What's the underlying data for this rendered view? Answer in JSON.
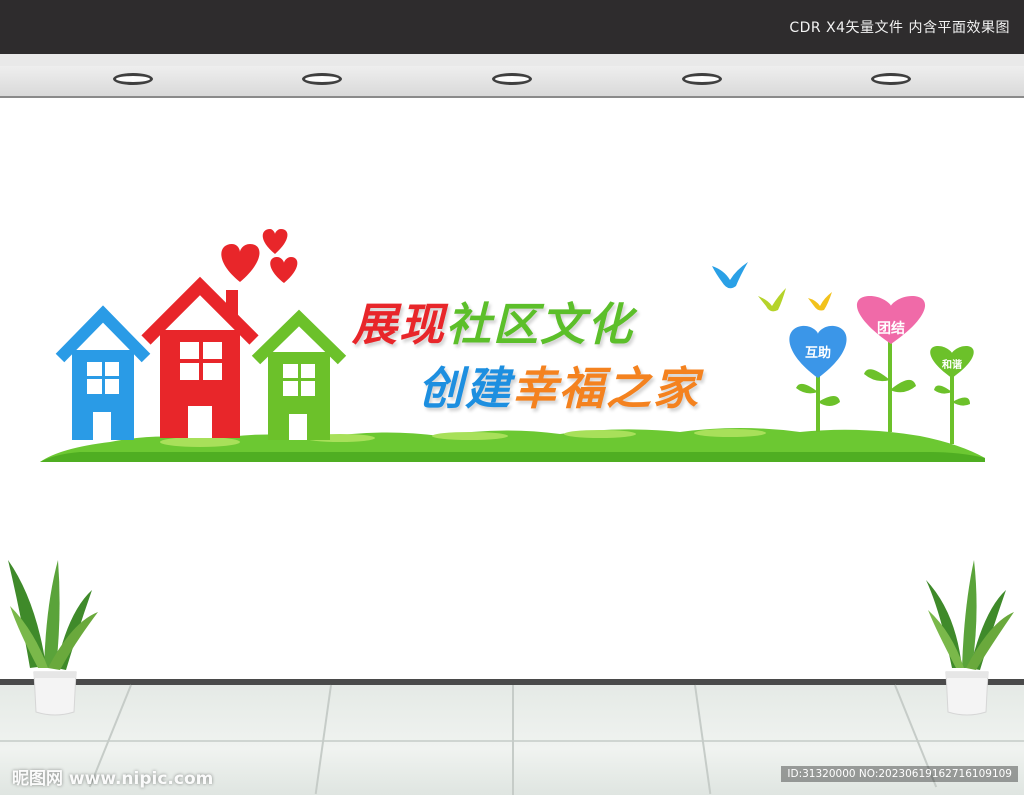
{
  "header": {
    "file_info": "CDR X4矢量文件  内含平面效果图"
  },
  "slogan": {
    "line1": {
      "part1": "展现",
      "part2": "社区文化"
    },
    "line2": {
      "part1": "创建",
      "part2": "幸福之家"
    }
  },
  "hearts": [
    {
      "label": "互助"
    },
    {
      "label": "团结"
    },
    {
      "label": "和谐"
    }
  ],
  "watermark": {
    "left": "昵图网 www.nipic.com",
    "right": "ID:31320000 NO:20230619162716109109"
  },
  "colors": {
    "house_blue": "#2a9be6",
    "house_red": "#e8262a",
    "house_green": "#6cc12a",
    "heart_red": "#e8262a",
    "grass": "#6cc832",
    "heart_blue": "#3b96e8",
    "heart_pink": "#f06aa8",
    "heart_green": "#6cc12a"
  },
  "icons": [
    "heart-icon",
    "bird-icon",
    "house-icon",
    "sprout-icon",
    "plant-icon",
    "ceiling-light-icon"
  ]
}
